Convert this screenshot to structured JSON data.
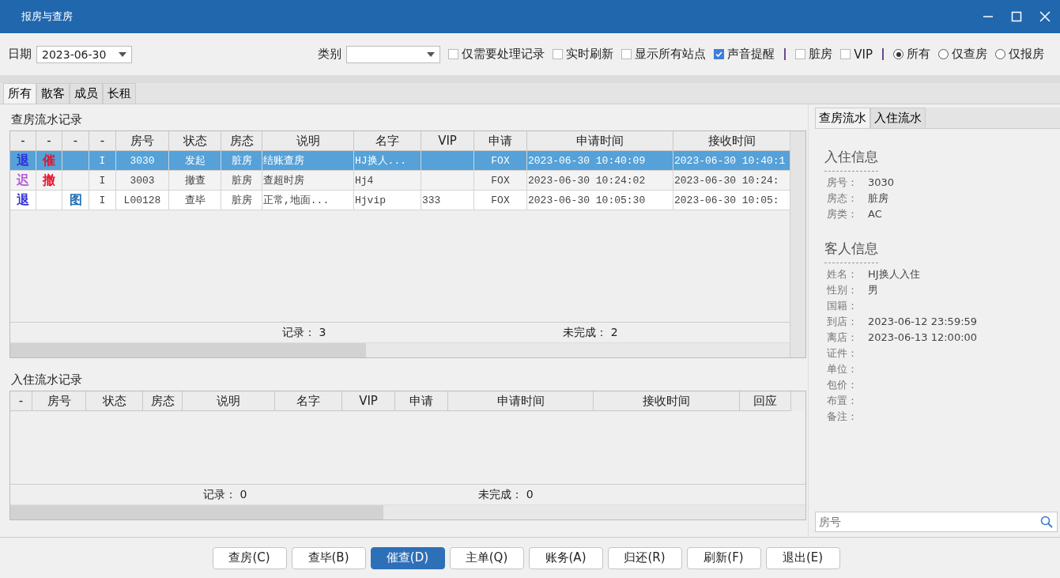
{
  "window": {
    "title": "报房与查房"
  },
  "toolbar": {
    "date_label": "日期",
    "date": "2023-06-30",
    "category_label": "类别",
    "checkboxes": [
      {
        "label": "仅需要处理记录",
        "checked": false
      },
      {
        "label": "实时刷新",
        "checked": false
      },
      {
        "label": "显示所有站点",
        "checked": false
      },
      {
        "label": "声音提醒",
        "checked": true
      }
    ],
    "filters": [
      {
        "label": "脏房",
        "checked": false
      },
      {
        "label": "VIP",
        "checked": false
      }
    ],
    "radios": [
      {
        "label": "所有",
        "selected": true
      },
      {
        "label": "仅查房",
        "selected": false
      },
      {
        "label": "仅报房",
        "selected": false
      }
    ]
  },
  "tabs": [
    {
      "label": "所有",
      "selected": true
    },
    {
      "label": "散客",
      "selected": false
    },
    {
      "label": "成员",
      "selected": false
    },
    {
      "label": "长租",
      "selected": false
    }
  ],
  "check_table": {
    "title": "查房流水记录",
    "columns": [
      "-",
      "-",
      "-",
      "-",
      "房号",
      "状态",
      "房态",
      "说明",
      "名字",
      "VIP",
      "申请",
      "申请时间",
      "接收时间"
    ],
    "rows": [
      {
        "selected": true,
        "cells": [
          {
            "text": "退",
            "color": "#2f2fd8"
          },
          {
            "text": "催",
            "color": "#e8102c"
          },
          "",
          "I",
          "3030",
          "发起",
          "脏房",
          "结账查房",
          "HJ换人...",
          "",
          "FOX",
          "2023-06-30 10:40:09",
          "2023-06-30 10:40:1"
        ]
      },
      {
        "selected": false,
        "cells": [
          {
            "text": "迟",
            "color": "#b45ad2"
          },
          {
            "text": "撤",
            "color": "#e8102c"
          },
          "",
          "I",
          "3003",
          "撤查",
          "脏房",
          "查超时房",
          "Hj4",
          "",
          "FOX",
          "2023-06-30 10:24:02",
          "2023-06-30 10:24:"
        ]
      },
      {
        "selected": false,
        "cells": [
          {
            "text": "退",
            "color": "#2f2fd8"
          },
          "",
          {
            "text": "图",
            "color": "#1f6fb5"
          },
          "I",
          "L00128",
          "查毕",
          "脏房",
          "正常,地面...",
          "Hjvip",
          "333",
          "FOX",
          "2023-06-30 10:05:30",
          "2023-06-30 10:05:"
        ]
      }
    ],
    "records_label": "记录：",
    "records": "3",
    "pending_label": "未完成：",
    "pending": "2"
  },
  "checkin_table": {
    "title": "入住流水记录",
    "columns": [
      "-",
      "房号",
      "状态",
      "房态",
      "说明",
      "名字",
      "VIP",
      "申请",
      "申请时间",
      "接收时间",
      "回应"
    ],
    "records_label": "记录：",
    "records": "0",
    "pending_label": "未完成：",
    "pending": "0"
  },
  "side_tabs": [
    {
      "label": "查房流水",
      "selected": true
    },
    {
      "label": "入住流水",
      "selected": false
    }
  ],
  "sections": [
    {
      "title": "入住信息",
      "fields": [
        {
          "label": "房号：",
          "value": "3030"
        },
        {
          "label": "房态：",
          "value": "脏房"
        },
        {
          "label": "房类：",
          "value": "AC"
        }
      ]
    },
    {
      "title": "客人信息",
      "fields": [
        {
          "label": "姓名：",
          "value": "HJ换人入住"
        },
        {
          "label": "性别：",
          "value": "男"
        },
        {
          "label": "国籍："
        },
        {
          "label": "到店：",
          "value": "2023-06-12 23:59:59"
        },
        {
          "label": "离店：",
          "value": "2023-06-13 12:00:00"
        },
        {
          "label": "证件："
        },
        {
          "label": "单位："
        },
        {
          "label": "包价："
        },
        {
          "label": "布置："
        },
        {
          "label": "备注："
        }
      ]
    }
  ],
  "search": {
    "placeholder": "房号"
  },
  "buttons": [
    {
      "label": "查房(C)",
      "selected": false
    },
    {
      "label": "查毕(B)",
      "selected": false
    },
    {
      "label": "催查(D)",
      "selected": true
    },
    {
      "label": "主单(Q)",
      "selected": false
    },
    {
      "label": "账务(A)",
      "selected": false
    },
    {
      "label": "归还(R)",
      "selected": false
    },
    {
      "label": "刷新(F)",
      "selected": false
    },
    {
      "label": "退出(E)",
      "selected": false
    }
  ]
}
